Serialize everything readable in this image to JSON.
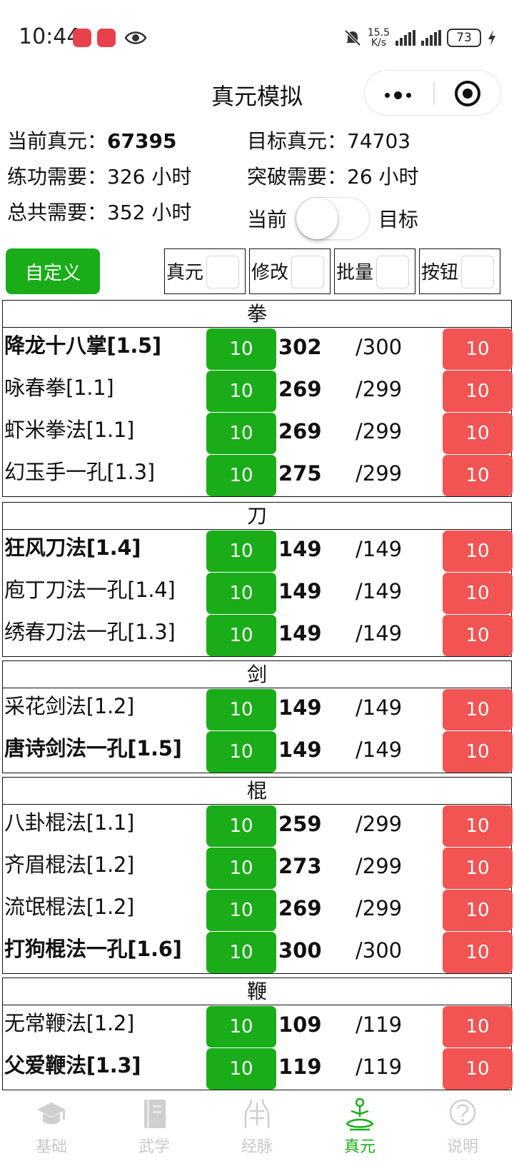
{
  "status_bar": {
    "time": "10:44",
    "net_speed_value": "15.5",
    "net_speed_unit": "K/s",
    "battery": "73"
  },
  "header": {
    "title": "真元模拟"
  },
  "stats": {
    "current_label": "当前真元：",
    "current_value": "67395",
    "target_label": "目标真元：",
    "target_value": "74703",
    "practice_label": "练功需要：",
    "practice_value": "326 小时",
    "breakthrough_label": "突破需要：",
    "breakthrough_value": "26 小时",
    "total_label": "总共需要：",
    "total_value": "352 小时"
  },
  "toggle": {
    "left_label": "当前",
    "right_label": "目标",
    "on": false
  },
  "controls": {
    "custom_button": "自定义",
    "checkboxes": [
      {
        "label": "真元",
        "checked": false
      },
      {
        "label": "修改",
        "checked": false
      },
      {
        "label": "批量",
        "checked": false
      },
      {
        "label": "按钮",
        "checked": false
      }
    ]
  },
  "groups": [
    {
      "name": "拳",
      "rows": [
        {
          "name": "降龙十八掌[1.5]",
          "bold": true,
          "plus": "10",
          "current": "302",
          "max": "/300",
          "minus": "10"
        },
        {
          "name": "咏春拳[1.1]",
          "bold": false,
          "plus": "10",
          "current": "269",
          "max": "/299",
          "minus": "10"
        },
        {
          "name": "虾米拳法[1.1]",
          "bold": false,
          "plus": "10",
          "current": "269",
          "max": "/299",
          "minus": "10"
        },
        {
          "name": "幻玉手一孔[1.3]",
          "bold": false,
          "plus": "10",
          "current": "275",
          "max": "/299",
          "minus": "10"
        }
      ]
    },
    {
      "name": "刀",
      "rows": [
        {
          "name": "狂风刀法[1.4]",
          "bold": true,
          "plus": "10",
          "current": "149",
          "max": "/149",
          "minus": "10"
        },
        {
          "name": "庖丁刀法一孔[1.4]",
          "bold": false,
          "plus": "10",
          "current": "149",
          "max": "/149",
          "minus": "10"
        },
        {
          "name": "绣春刀法一孔[1.3]",
          "bold": false,
          "plus": "10",
          "current": "149",
          "max": "/149",
          "minus": "10"
        }
      ]
    },
    {
      "name": "剑",
      "rows": [
        {
          "name": "采花剑法[1.2]",
          "bold": false,
          "plus": "10",
          "current": "149",
          "max": "/149",
          "minus": "10"
        },
        {
          "name": "唐诗剑法一孔[1.5]",
          "bold": true,
          "plus": "10",
          "current": "149",
          "max": "/149",
          "minus": "10"
        }
      ]
    },
    {
      "name": "棍",
      "rows": [
        {
          "name": "八卦棍法[1.1]",
          "bold": false,
          "plus": "10",
          "current": "259",
          "max": "/299",
          "minus": "10"
        },
        {
          "name": "齐眉棍法[1.2]",
          "bold": false,
          "plus": "10",
          "current": "273",
          "max": "/299",
          "minus": "10"
        },
        {
          "name": "流氓棍法[1.2]",
          "bold": false,
          "plus": "10",
          "current": "269",
          "max": "/299",
          "minus": "10"
        },
        {
          "name": "打狗棍法一孔[1.6]",
          "bold": true,
          "plus": "10",
          "current": "300",
          "max": "/300",
          "minus": "10"
        }
      ]
    },
    {
      "name": "鞭",
      "rows": [
        {
          "name": "无常鞭法[1.2]",
          "bold": false,
          "plus": "10",
          "current": "109",
          "max": "/119",
          "minus": "10"
        },
        {
          "name": "父爱鞭法[1.3]",
          "bold": true,
          "plus": "10",
          "current": "119",
          "max": "/119",
          "minus": "10"
        }
      ]
    }
  ],
  "tabbar": {
    "tabs": [
      {
        "label": "基础",
        "icon": "scholar-hat-icon",
        "active": false
      },
      {
        "label": "武学",
        "icon": "book-icon",
        "active": false
      },
      {
        "label": "经脉",
        "icon": "meridian-body-icon",
        "active": false
      },
      {
        "label": "真元",
        "icon": "meditation-icon",
        "active": true
      },
      {
        "label": "说明",
        "icon": "help-icon",
        "active": false
      }
    ]
  },
  "colors": {
    "green": "#1aad19",
    "red": "#f25353",
    "tab_inactive": "#c8c8c8"
  }
}
